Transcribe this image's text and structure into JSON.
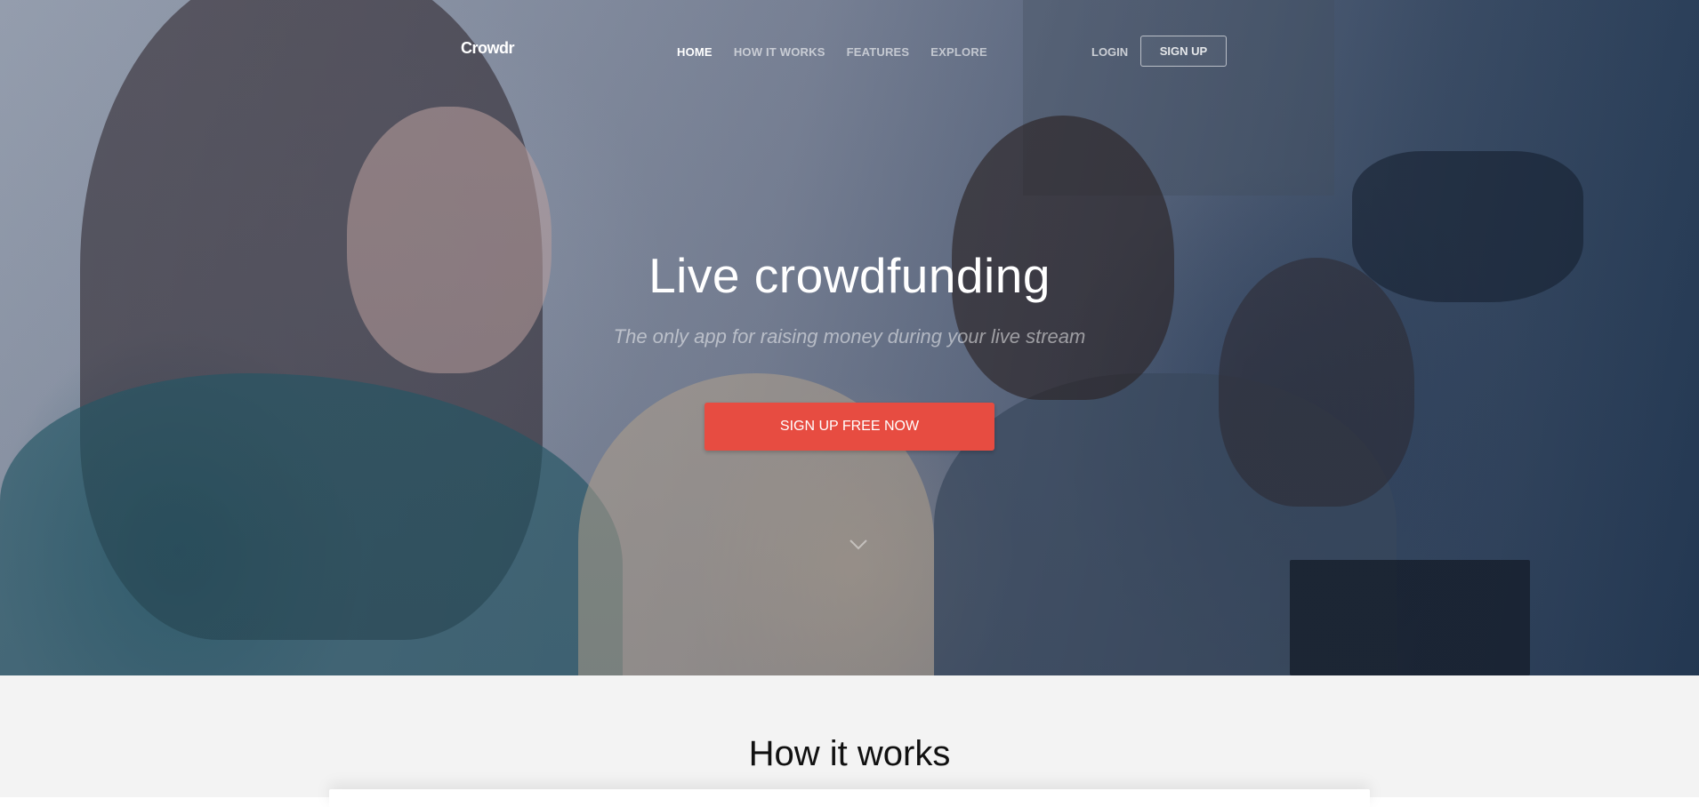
{
  "brand": {
    "logo_text": "Crowdr"
  },
  "nav": {
    "items": [
      {
        "label": "HOME",
        "active": true
      },
      {
        "label": "HOW IT WORKS",
        "active": false
      },
      {
        "label": "FEATURES",
        "active": false
      },
      {
        "label": "EXPLORE",
        "active": false
      }
    ],
    "login_label": "LOGIN",
    "signup_label": "SIGN UP"
  },
  "hero": {
    "title": "Live crowdfunding",
    "subtitle": "The only app for raising money during your live stream",
    "cta_label": "SIGN UP FREE NOW",
    "cta_color": "#e74c41",
    "scroll_icon": "chevron-down-icon"
  },
  "section": {
    "title": "How it works"
  }
}
